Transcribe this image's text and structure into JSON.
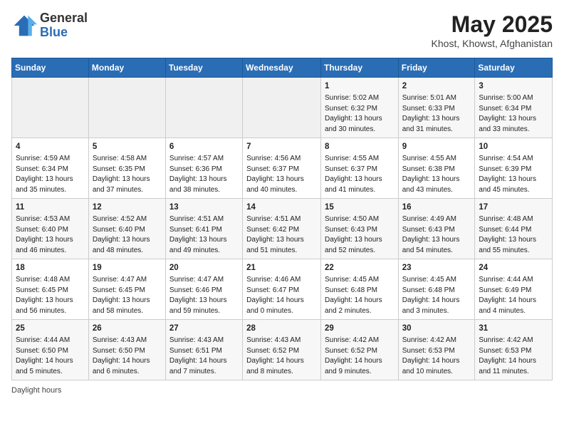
{
  "logo": {
    "general": "General",
    "blue": "Blue"
  },
  "title": "May 2025",
  "subtitle": "Khost, Khowst, Afghanistan",
  "days_of_week": [
    "Sunday",
    "Monday",
    "Tuesday",
    "Wednesday",
    "Thursday",
    "Friday",
    "Saturday"
  ],
  "weeks": [
    [
      {
        "day": "",
        "info": ""
      },
      {
        "day": "",
        "info": ""
      },
      {
        "day": "",
        "info": ""
      },
      {
        "day": "",
        "info": ""
      },
      {
        "day": "1",
        "info": "Sunrise: 5:02 AM\nSunset: 6:32 PM\nDaylight: 13 hours\nand 30 minutes."
      },
      {
        "day": "2",
        "info": "Sunrise: 5:01 AM\nSunset: 6:33 PM\nDaylight: 13 hours\nand 31 minutes."
      },
      {
        "day": "3",
        "info": "Sunrise: 5:00 AM\nSunset: 6:34 PM\nDaylight: 13 hours\nand 33 minutes."
      }
    ],
    [
      {
        "day": "4",
        "info": "Sunrise: 4:59 AM\nSunset: 6:34 PM\nDaylight: 13 hours\nand 35 minutes."
      },
      {
        "day": "5",
        "info": "Sunrise: 4:58 AM\nSunset: 6:35 PM\nDaylight: 13 hours\nand 37 minutes."
      },
      {
        "day": "6",
        "info": "Sunrise: 4:57 AM\nSunset: 6:36 PM\nDaylight: 13 hours\nand 38 minutes."
      },
      {
        "day": "7",
        "info": "Sunrise: 4:56 AM\nSunset: 6:37 PM\nDaylight: 13 hours\nand 40 minutes."
      },
      {
        "day": "8",
        "info": "Sunrise: 4:55 AM\nSunset: 6:37 PM\nDaylight: 13 hours\nand 41 minutes."
      },
      {
        "day": "9",
        "info": "Sunrise: 4:55 AM\nSunset: 6:38 PM\nDaylight: 13 hours\nand 43 minutes."
      },
      {
        "day": "10",
        "info": "Sunrise: 4:54 AM\nSunset: 6:39 PM\nDaylight: 13 hours\nand 45 minutes."
      }
    ],
    [
      {
        "day": "11",
        "info": "Sunrise: 4:53 AM\nSunset: 6:40 PM\nDaylight: 13 hours\nand 46 minutes."
      },
      {
        "day": "12",
        "info": "Sunrise: 4:52 AM\nSunset: 6:40 PM\nDaylight: 13 hours\nand 48 minutes."
      },
      {
        "day": "13",
        "info": "Sunrise: 4:51 AM\nSunset: 6:41 PM\nDaylight: 13 hours\nand 49 minutes."
      },
      {
        "day": "14",
        "info": "Sunrise: 4:51 AM\nSunset: 6:42 PM\nDaylight: 13 hours\nand 51 minutes."
      },
      {
        "day": "15",
        "info": "Sunrise: 4:50 AM\nSunset: 6:43 PM\nDaylight: 13 hours\nand 52 minutes."
      },
      {
        "day": "16",
        "info": "Sunrise: 4:49 AM\nSunset: 6:43 PM\nDaylight: 13 hours\nand 54 minutes."
      },
      {
        "day": "17",
        "info": "Sunrise: 4:48 AM\nSunset: 6:44 PM\nDaylight: 13 hours\nand 55 minutes."
      }
    ],
    [
      {
        "day": "18",
        "info": "Sunrise: 4:48 AM\nSunset: 6:45 PM\nDaylight: 13 hours\nand 56 minutes."
      },
      {
        "day": "19",
        "info": "Sunrise: 4:47 AM\nSunset: 6:45 PM\nDaylight: 13 hours\nand 58 minutes."
      },
      {
        "day": "20",
        "info": "Sunrise: 4:47 AM\nSunset: 6:46 PM\nDaylight: 13 hours\nand 59 minutes."
      },
      {
        "day": "21",
        "info": "Sunrise: 4:46 AM\nSunset: 6:47 PM\nDaylight: 14 hours\nand 0 minutes."
      },
      {
        "day": "22",
        "info": "Sunrise: 4:45 AM\nSunset: 6:48 PM\nDaylight: 14 hours\nand 2 minutes."
      },
      {
        "day": "23",
        "info": "Sunrise: 4:45 AM\nSunset: 6:48 PM\nDaylight: 14 hours\nand 3 minutes."
      },
      {
        "day": "24",
        "info": "Sunrise: 4:44 AM\nSunset: 6:49 PM\nDaylight: 14 hours\nand 4 minutes."
      }
    ],
    [
      {
        "day": "25",
        "info": "Sunrise: 4:44 AM\nSunset: 6:50 PM\nDaylight: 14 hours\nand 5 minutes."
      },
      {
        "day": "26",
        "info": "Sunrise: 4:43 AM\nSunset: 6:50 PM\nDaylight: 14 hours\nand 6 minutes."
      },
      {
        "day": "27",
        "info": "Sunrise: 4:43 AM\nSunset: 6:51 PM\nDaylight: 14 hours\nand 7 minutes."
      },
      {
        "day": "28",
        "info": "Sunrise: 4:43 AM\nSunset: 6:52 PM\nDaylight: 14 hours\nand 8 minutes."
      },
      {
        "day": "29",
        "info": "Sunrise: 4:42 AM\nSunset: 6:52 PM\nDaylight: 14 hours\nand 9 minutes."
      },
      {
        "day": "30",
        "info": "Sunrise: 4:42 AM\nSunset: 6:53 PM\nDaylight: 14 hours\nand 10 minutes."
      },
      {
        "day": "31",
        "info": "Sunrise: 4:42 AM\nSunset: 6:53 PM\nDaylight: 14 hours\nand 11 minutes."
      }
    ]
  ],
  "footer": "Daylight hours"
}
